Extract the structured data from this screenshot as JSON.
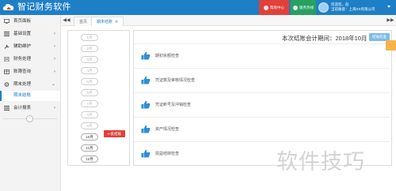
{
  "header": {
    "app_title": "智记财务软件",
    "red_button": "帮助中心",
    "green_button": "服务热线",
    "user_line1": "欢迎您，赵",
    "user_line2": "当前账套：上海XX有限公司"
  },
  "sidebar": {
    "items": [
      {
        "label": "首页面板"
      },
      {
        "label": "基础设置"
      },
      {
        "label": "辅助维护"
      },
      {
        "label": "财务处理"
      },
      {
        "label": "账簿查询"
      },
      {
        "label": "期末处理"
      },
      {
        "label": "会计报表"
      }
    ],
    "sub_item": "期末结账",
    "collapse": "−"
  },
  "tabs": {
    "home": "首页",
    "active": "期末结账",
    "close": "⊗",
    "prev": "◀◀",
    "next": "▶▶"
  },
  "months": [
    {
      "label": "1月",
      "enabled": false
    },
    {
      "label": "2月",
      "enabled": false
    },
    {
      "label": "3月",
      "enabled": false
    },
    {
      "label": "4月",
      "enabled": false
    },
    {
      "label": "5月",
      "enabled": false
    },
    {
      "label": "6月",
      "enabled": false
    },
    {
      "label": "7月",
      "enabled": false
    },
    {
      "label": "8月",
      "enabled": false
    },
    {
      "label": "9月",
      "enabled": false
    },
    {
      "label": "10月",
      "enabled": true
    },
    {
      "label": "11月",
      "enabled": true
    },
    {
      "label": "12月",
      "enabled": true
    }
  ],
  "unclose_button": "反结账",
  "panel": {
    "period_label": "本次结账会计期间：2018年10月",
    "period_button": "结账检查",
    "checks": [
      "期初余额检查",
      "凭证数及审核情况检查",
      "凭证断号及冲销检查",
      "资产情况检查",
      "损益结转检查"
    ]
  },
  "watermark": "软件技巧",
  "colors": {
    "brand": "#1f7fc6",
    "danger": "#e0413a",
    "success": "#27a061",
    "accent_orange": "#f6b24c",
    "thumb_icon": "#2f8fd6"
  }
}
